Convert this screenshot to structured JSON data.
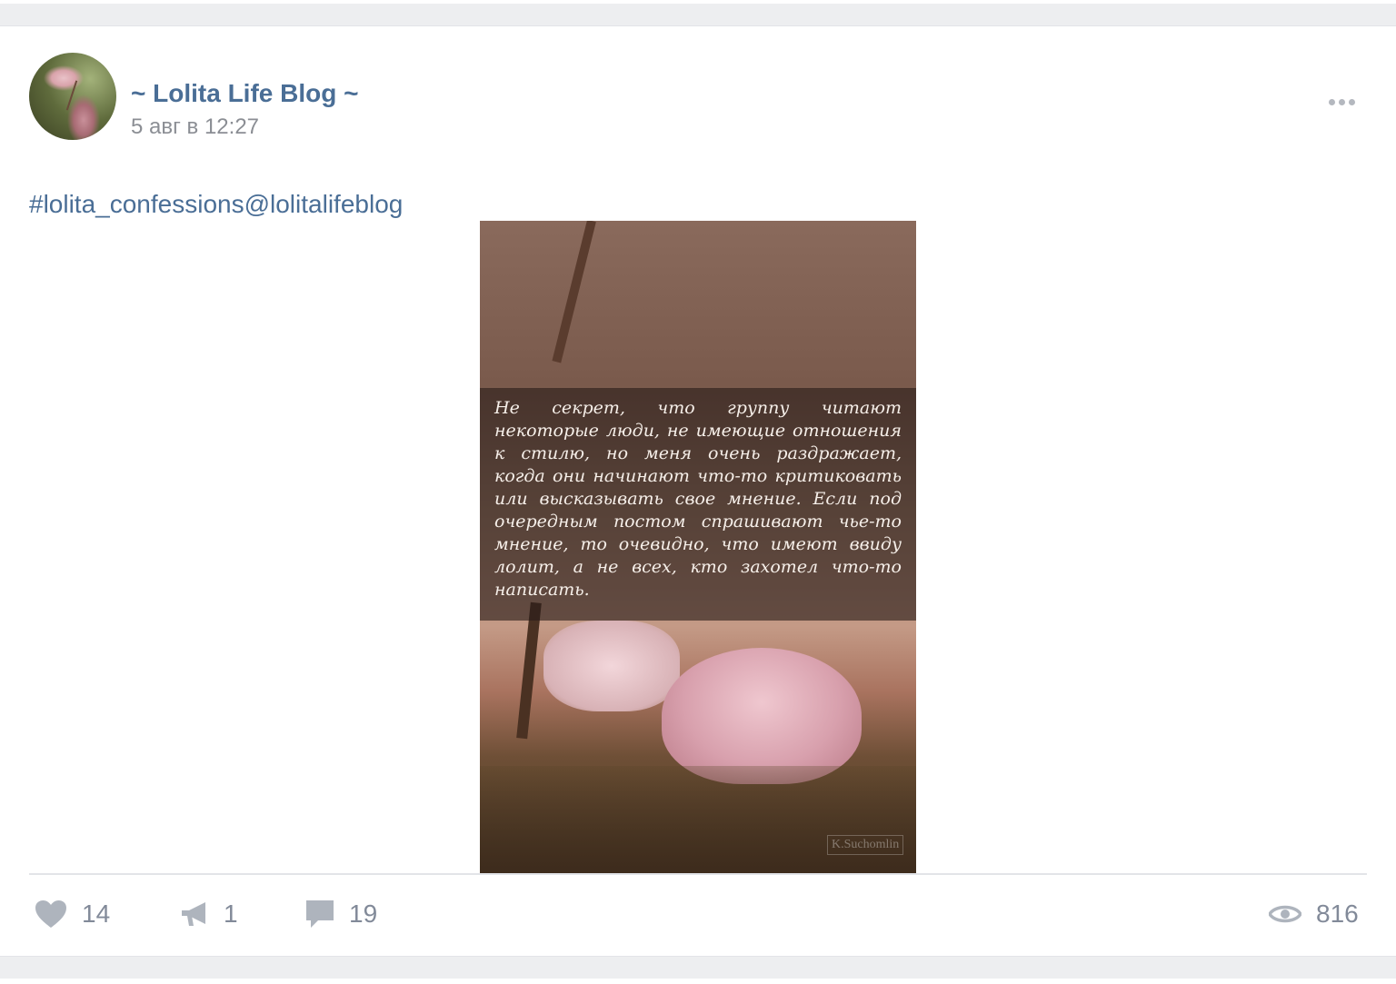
{
  "post": {
    "author": "~ Lolita Life Blog ~",
    "date": "5 авг в 12:27",
    "hashtag": "#lolita_confessions@lolitalifeblog",
    "image_text": "Не секрет, что группу читают некоторые люди, не имеющие отношения к стилю, но меня очень раздражает, когда они начинают что-то критиковать или высказывать свое мнение. Если под очередным постом спрашивают чье-то мнение, то очевидно, что имеют ввиду лолит, а не всех, кто захотел что-то написать.",
    "watermark": "K.Suchomlin"
  },
  "actions": {
    "likes": "14",
    "shares": "1",
    "comments": "19",
    "views": "816"
  },
  "icons": {
    "like": "heart-icon",
    "share": "megaphone-icon",
    "comment": "comment-icon",
    "views": "eye-icon",
    "more": "more-dots-icon"
  },
  "colors": {
    "link": "#4a6e96",
    "muted": "#828a99",
    "icon": "#aeb4bd",
    "background": "#edeef0"
  }
}
